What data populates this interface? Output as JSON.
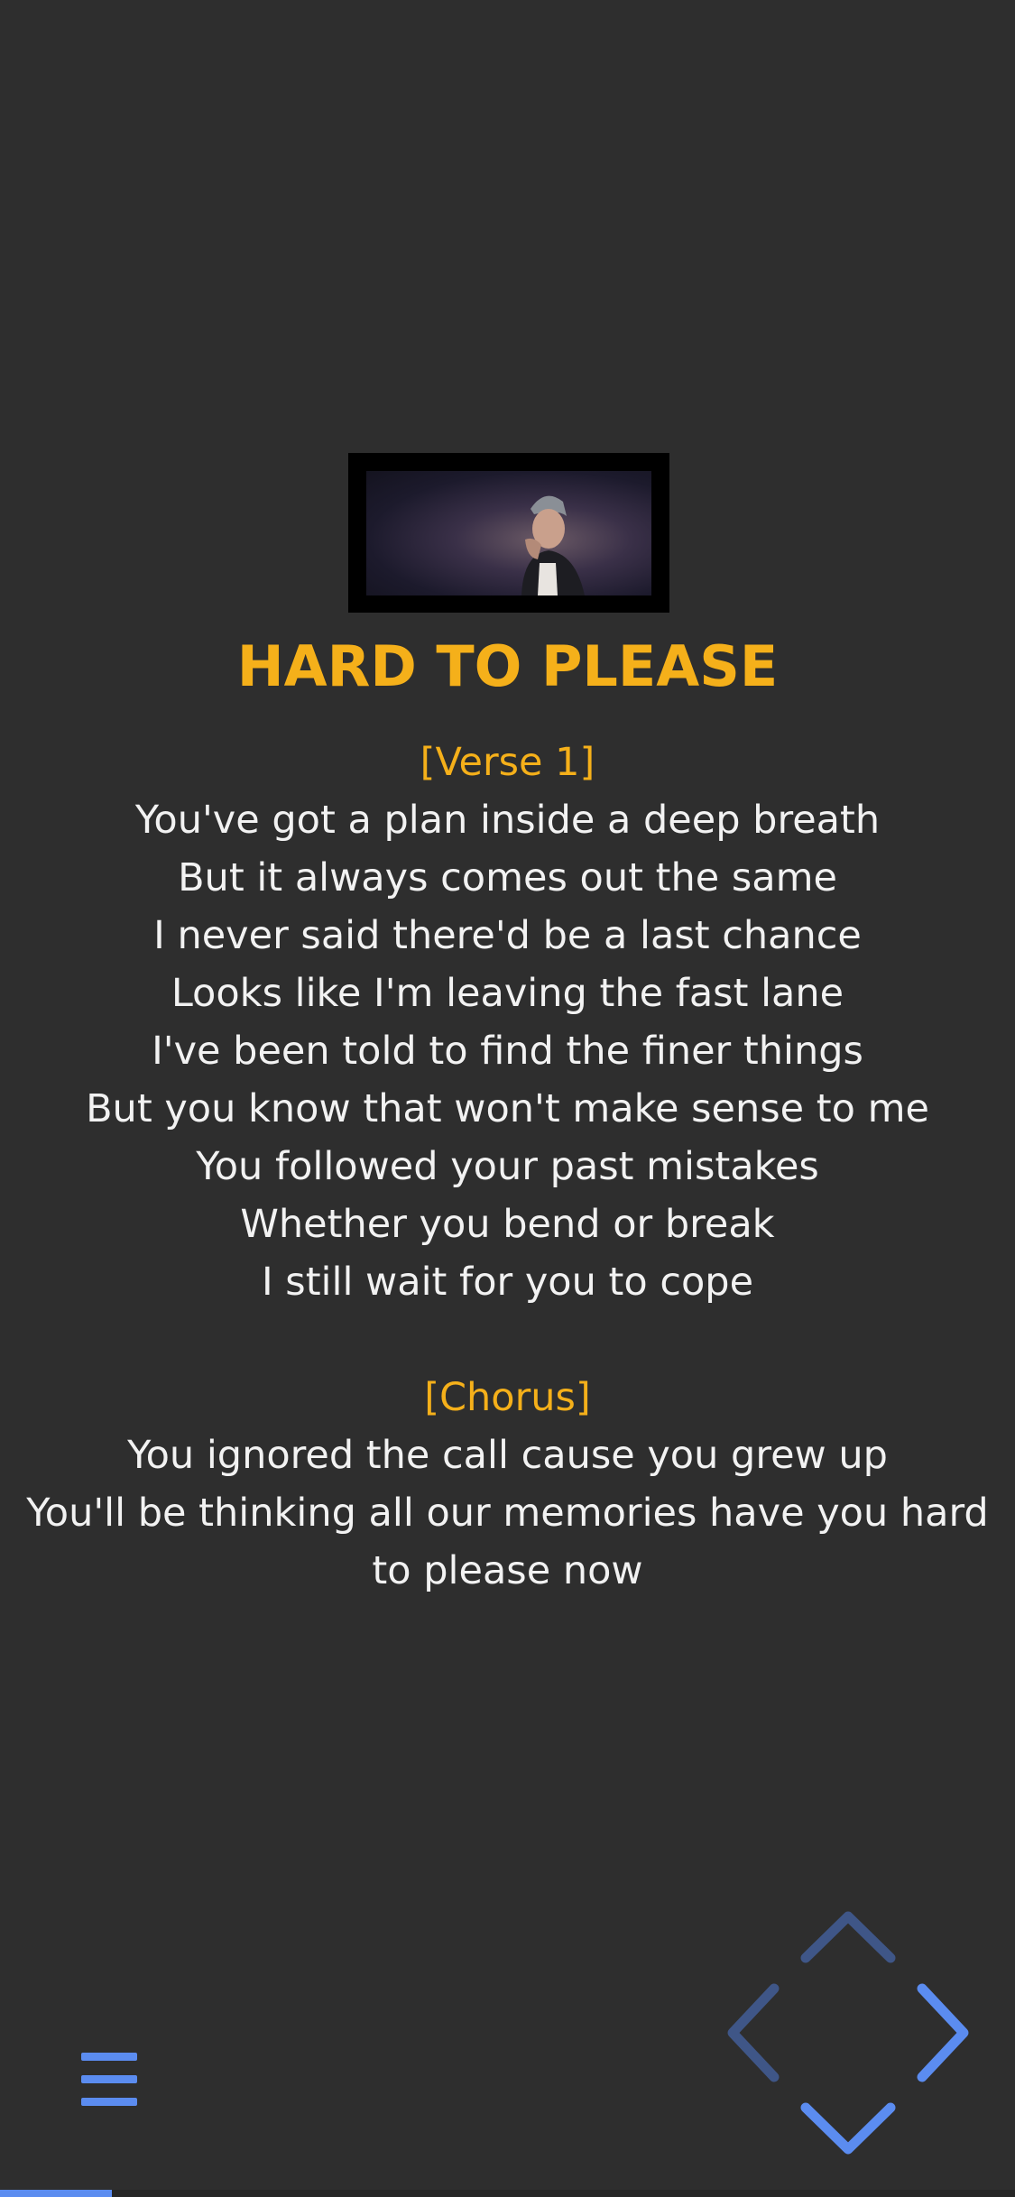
{
  "song": {
    "title": "HARD TO PLEASE"
  },
  "lyrics": {
    "verse1_label": "[Verse 1]",
    "verse1_lines": [
      "You've got a plan inside a deep breath",
      "But it always comes out the same",
      "I never said there'd be a last chance",
      "Looks like I'm leaving the fast lane",
      "I've been told to find the finer things",
      "But you know that won't make sense to me",
      "You followed your past mistakes",
      "Whether you bend or break",
      "I still wait for you to cope"
    ],
    "chorus_label": "[Chorus]",
    "chorus_lines": [
      "You ignored the call cause you grew up",
      "You'll be thinking all our memories have you hard to please now"
    ]
  },
  "controls": {
    "menu_icon": "hamburger-menu-icon",
    "up_icon": "chevron-up-icon",
    "left_icon": "chevron-left-icon",
    "right_icon": "chevron-right-icon",
    "down_icon": "chevron-down-icon"
  },
  "playback": {
    "progress_fraction": 0.11
  },
  "colors": {
    "background": "#2e2e2e",
    "accent_title": "#f5b01a",
    "lyric_text": "#f2f2f2",
    "control_blue": "#5b8cf0",
    "control_blue_dim": "#3f5687"
  }
}
